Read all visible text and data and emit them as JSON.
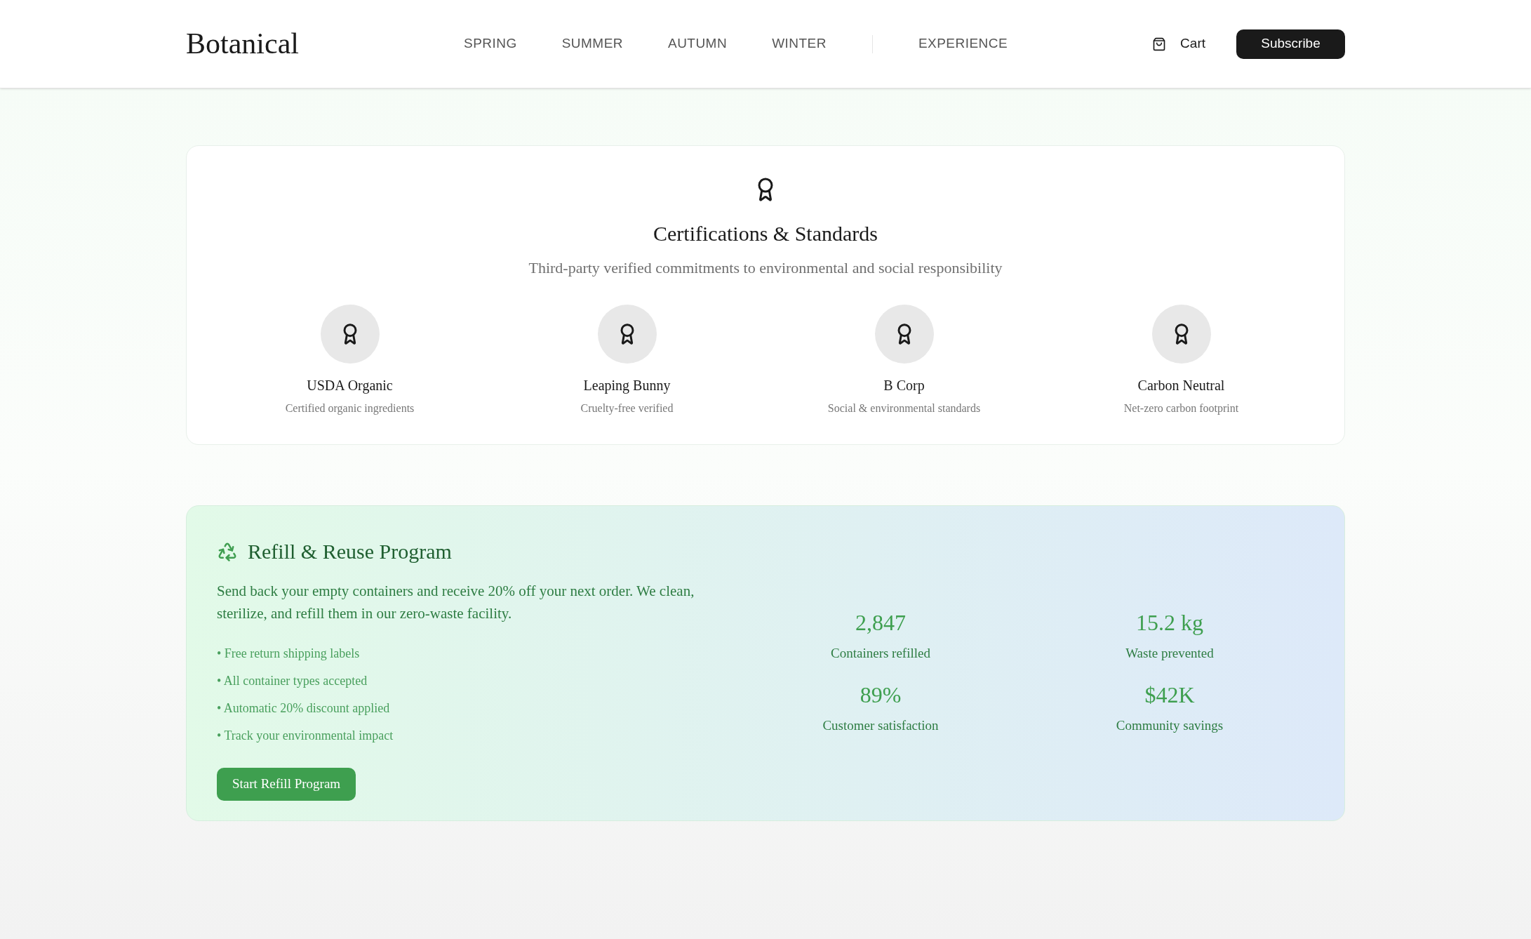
{
  "header": {
    "logo": "Botanical",
    "nav": [
      {
        "label": "SPRING",
        "selected": false
      },
      {
        "label": "SUMMER",
        "selected": false
      },
      {
        "label": "AUTUMN",
        "selected": false
      },
      {
        "label": "WINTER",
        "selected": false
      },
      {
        "label": "EXPERIENCE",
        "selected": false
      }
    ],
    "cart": "Cart",
    "subscribe": "Subscribe"
  },
  "certifications": {
    "title": "Certifications & Standards",
    "subtitle": "Third-party verified commitments to environmental and social responsibility",
    "items": [
      {
        "name": "USDA Organic",
        "description": "Certified organic ingredients"
      },
      {
        "name": "Leaping Bunny",
        "description": "Cruelty-free verified"
      },
      {
        "name": "B Corp",
        "description": "Social & environmental standards"
      },
      {
        "name": "Carbon Neutral",
        "description": "Net-zero carbon footprint"
      }
    ]
  },
  "refill": {
    "title": "Refill & Reuse Program",
    "description": "Send back your empty containers and receive 20% off your next order. We clean, sterilize, and refill them in our zero-waste facility.",
    "bullets": [
      "• Free return shipping labels",
      "• All container types accepted",
      "• Automatic 20% discount applied",
      "• Track your environmental impact"
    ],
    "button": "Start Refill Program",
    "stats": [
      {
        "value": "2,847",
        "label": "Containers refilled"
      },
      {
        "value": "15.2 kg",
        "label": "Waste prevented"
      },
      {
        "value": "89%",
        "label": "Customer satisfaction"
      },
      {
        "value": "$42K",
        "label": "Community savings"
      }
    ]
  }
}
